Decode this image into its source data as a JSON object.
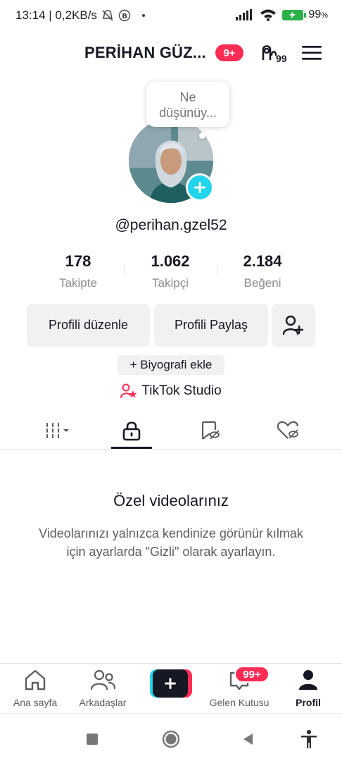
{
  "status_bar": {
    "time_info": "13:14 | 0,2KB/s",
    "battery": "99",
    "battery_unit": "%"
  },
  "header": {
    "profile_name": "PERİHAN GÜZ...",
    "notification_badge": "9+",
    "friends_count": "99"
  },
  "profile": {
    "note_bubble_line1": "Ne",
    "note_bubble_line2": "düşünüy...",
    "username": "@perihan.gzel52"
  },
  "stats": [
    {
      "value": "178",
      "label": "Takipte"
    },
    {
      "value": "1.062",
      "label": "Takipçi"
    },
    {
      "value": "2.184",
      "label": "Beğeni"
    }
  ],
  "actions": {
    "edit_profile": "Profili düzenle",
    "share_profile": "Profili Paylaş",
    "add_bio": "+ Biyografi ekle",
    "studio": "TikTok Studio"
  },
  "empty_state": {
    "title": "Özel videolarınız",
    "description": "Videolarınızı yalnızca kendinize görünür kılmak için ayarlarda \"Gizli\" olarak ayarlayın."
  },
  "bottom_nav": {
    "home": "Ana sayfa",
    "friends": "Arkadaşlar",
    "inbox": "Gelen Kutusu",
    "inbox_badge": "99+",
    "profile": "Profil"
  },
  "colors": {
    "accent": "#fe2c55",
    "cyan": "#20d5ec",
    "text": "#161823",
    "muted": "#8a8b91",
    "button_bg": "#f1f1f2"
  },
  "icons": {
    "tabs": [
      "grid-icon",
      "lock-icon",
      "bookmark-icon",
      "liked-icon"
    ]
  }
}
